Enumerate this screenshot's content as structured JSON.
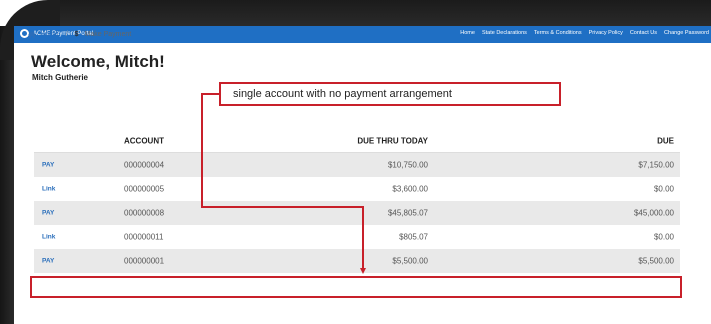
{
  "header": {
    "brand": "ACME Payment Portal",
    "nav": [
      "Home",
      "State Declarations",
      "Terms & Conditions",
      "Privacy Policy",
      "Contact Us",
      "Change Password"
    ]
  },
  "breadcrumb": {
    "home": "Home",
    "separator": "/",
    "current_icon": "$",
    "current": "Make Payment"
  },
  "welcome": {
    "title": "Welcome, Mitch!",
    "name": "Mitch Gutherie"
  },
  "table": {
    "headers": {
      "action": "",
      "account": "ACCOUNT",
      "due_thru": "DUE THRU TODAY",
      "due": "DUE"
    },
    "rows": [
      {
        "action": "PAY",
        "account": "000000004",
        "due_thru": "$10,750.00",
        "due": "$7,150.00"
      },
      {
        "action": "Link",
        "account": "000000005",
        "due_thru": "$3,600.00",
        "due": "$0.00"
      },
      {
        "action": "PAY",
        "account": "000000008",
        "due_thru": "$45,805.07",
        "due": "$45,000.00"
      },
      {
        "action": "Link",
        "account": "000000011",
        "due_thru": "$805.07",
        "due": "$0.00"
      },
      {
        "action": "PAY",
        "account": "000000001",
        "due_thru": "$5,500.00",
        "due": "$5,500.00"
      }
    ]
  },
  "annotation": {
    "text": "single account with no payment arrangement",
    "color": "#c8202a"
  },
  "colors": {
    "topbar": "#1f6fc4",
    "link": "#2a6ebb",
    "row_shade": "#e9e9e9"
  }
}
